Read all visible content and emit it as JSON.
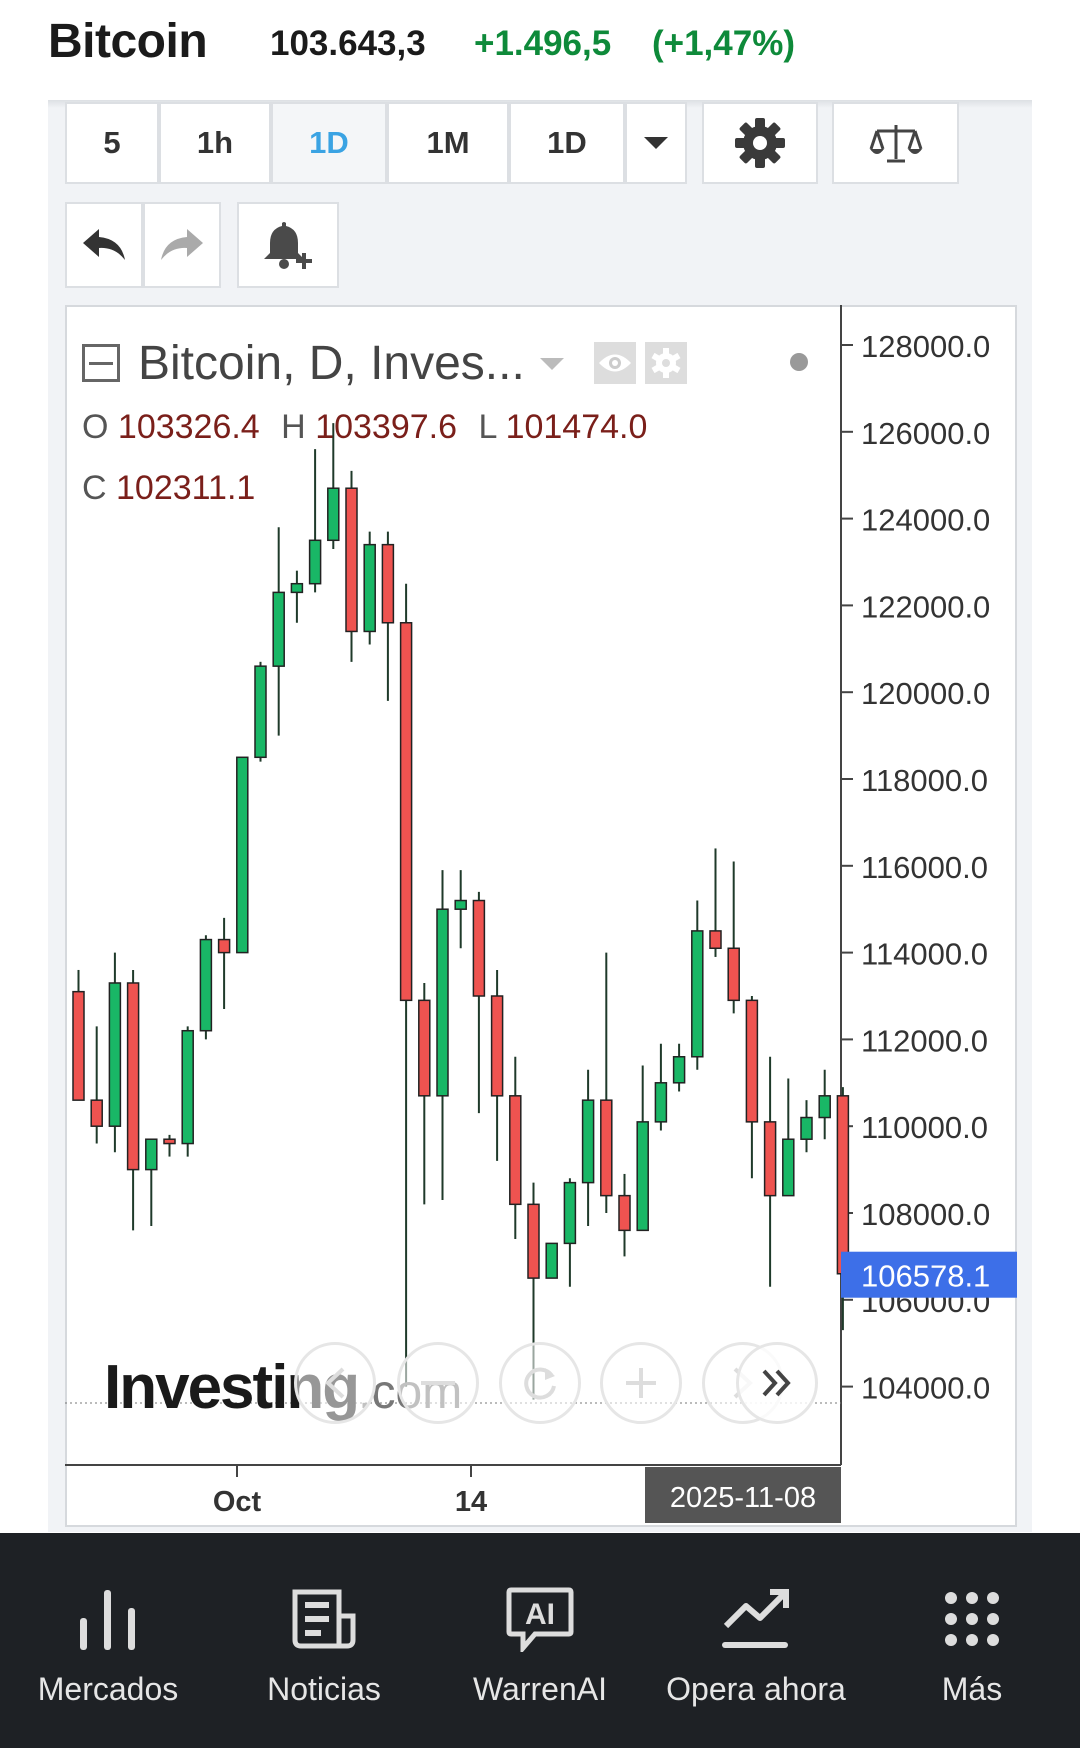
{
  "header": {
    "title": "Bitcoin",
    "price": "103.643,3",
    "change": "+1.496,5",
    "change_pct": "(+1,47%)",
    "up_color": "#0e8a3a"
  },
  "toolbar": {
    "intervals": [
      "5",
      "1h",
      "1D",
      "1M",
      "1D"
    ],
    "active_interval": "1D",
    "dropdown_icon": "caret-down-icon",
    "settings_icon": "gear-icon",
    "compare_icon": "scale-icon",
    "undo_icon": "undo-icon",
    "redo_icon": "redo-icon",
    "alert_icon": "bell-plus-icon"
  },
  "legend": {
    "title": "Bitcoin, D, Inves...",
    "o_label": "O",
    "o_value": "103326.4",
    "h_label": "H",
    "h_value": "103397.6",
    "l_label": "L",
    "l_value": "101474.0",
    "c_label": "C",
    "c_value": "102311.1"
  },
  "watermark": {
    "brand": "Investing",
    "suffix": ".com"
  },
  "nav_controls": [
    "chevron-left-icon",
    "minus-icon",
    "reset-icon",
    "plus-icon",
    "chevron-right-icon",
    "double-chevron-right-icon"
  ],
  "chart_data": {
    "type": "candlestick",
    "ylim": [
      102000,
      129000
    ],
    "y_ticks": [
      "128000.0",
      "126000.0",
      "124000.0",
      "122000.0",
      "120000.0",
      "118000.0",
      "116000.0",
      "114000.0",
      "112000.0",
      "110000.0",
      "108000.0",
      "106000.0",
      "104000.0"
    ],
    "x_ticks": [
      "Oct",
      "14",
      "2025-11-08"
    ],
    "current_price_label": "106578.1",
    "colors": {
      "up": "#19b766",
      "down": "#ef5350",
      "wick": "#1f3a2a",
      "price_tag": "#3d6fe8"
    },
    "candles": [
      {
        "o": 113100,
        "h": 113600,
        "l": 112000,
        "c": 110600
      },
      {
        "o": 110600,
        "h": 112300,
        "l": 109600,
        "c": 110000
      },
      {
        "o": 110000,
        "h": 114000,
        "l": 109400,
        "c": 113300
      },
      {
        "o": 113300,
        "h": 113600,
        "l": 107600,
        "c": 109000
      },
      {
        "o": 109000,
        "h": 109500,
        "l": 107700,
        "c": 109700
      },
      {
        "o": 109700,
        "h": 109800,
        "l": 109300,
        "c": 109600
      },
      {
        "o": 109600,
        "h": 112300,
        "l": 109300,
        "c": 112200
      },
      {
        "o": 112200,
        "h": 114400,
        "l": 112000,
        "c": 114300
      },
      {
        "o": 114300,
        "h": 114800,
        "l": 112700,
        "c": 114000
      },
      {
        "o": 114000,
        "h": 118500,
        "l": 114000,
        "c": 118500
      },
      {
        "o": 118500,
        "h": 120700,
        "l": 118400,
        "c": 120600
      },
      {
        "o": 120600,
        "h": 123800,
        "l": 119000,
        "c": 122300
      },
      {
        "o": 122300,
        "h": 122800,
        "l": 121600,
        "c": 122500
      },
      {
        "o": 122500,
        "h": 125600,
        "l": 122300,
        "c": 123500
      },
      {
        "o": 123500,
        "h": 126200,
        "l": 123300,
        "c": 124700
      },
      {
        "o": 124700,
        "h": 125100,
        "l": 120700,
        "c": 121400
      },
      {
        "o": 121400,
        "h": 123700,
        "l": 121100,
        "c": 123400
      },
      {
        "o": 123400,
        "h": 123700,
        "l": 119800,
        "c": 121600
      },
      {
        "o": 121600,
        "h": 122500,
        "l": 104000,
        "c": 112900
      },
      {
        "o": 112900,
        "h": 113300,
        "l": 108200,
        "c": 110700
      },
      {
        "o": 110700,
        "h": 115900,
        "l": 108300,
        "c": 115000
      },
      {
        "o": 115000,
        "h": 115900,
        "l": 114100,
        "c": 115200
      },
      {
        "o": 115200,
        "h": 115400,
        "l": 110300,
        "c": 113000
      },
      {
        "o": 113000,
        "h": 113600,
        "l": 109200,
        "c": 110700
      },
      {
        "o": 110700,
        "h": 111600,
        "l": 107400,
        "c": 108200
      },
      {
        "o": 108200,
        "h": 108700,
        "l": 103700,
        "c": 106500
      },
      {
        "o": 106500,
        "h": 107200,
        "l": 106500,
        "c": 107300
      },
      {
        "o": 107300,
        "h": 108800,
        "l": 106300,
        "c": 108700
      },
      {
        "o": 108700,
        "h": 111300,
        "l": 107700,
        "c": 110600
      },
      {
        "o": 110600,
        "h": 114000,
        "l": 108000,
        "c": 108400
      },
      {
        "o": 108400,
        "h": 108900,
        "l": 107000,
        "c": 107600
      },
      {
        "o": 107600,
        "h": 111400,
        "l": 107600,
        "c": 110100
      },
      {
        "o": 110100,
        "h": 111900,
        "l": 109900,
        "c": 111000
      },
      {
        "o": 111000,
        "h": 111900,
        "l": 110800,
        "c": 111600
      },
      {
        "o": 111600,
        "h": 115200,
        "l": 111300,
        "c": 114500
      },
      {
        "o": 114500,
        "h": 116400,
        "l": 113900,
        "c": 114100
      },
      {
        "o": 114100,
        "h": 116100,
        "l": 112600,
        "c": 112900
      },
      {
        "o": 112900,
        "h": 113000,
        "l": 108800,
        "c": 110100
      },
      {
        "o": 110100,
        "h": 111600,
        "l": 106300,
        "c": 108400
      },
      {
        "o": 108400,
        "h": 111100,
        "l": 108400,
        "c": 109700
      },
      {
        "o": 109700,
        "h": 110600,
        "l": 109400,
        "c": 110200
      },
      {
        "o": 110200,
        "h": 111300,
        "l": 109700,
        "c": 110700
      },
      {
        "o": 110700,
        "h": 110900,
        "l": 105300,
        "c": 106600
      }
    ]
  },
  "bottom_nav": [
    {
      "label": "Mercados",
      "icon": "bar-chart-icon"
    },
    {
      "label": "Noticias",
      "icon": "newspaper-icon"
    },
    {
      "label": "WarrenAI",
      "icon": "ai-chat-icon"
    },
    {
      "label": "Opera ahora",
      "icon": "trend-up-icon"
    },
    {
      "label": "Más",
      "icon": "grid-dots-icon"
    }
  ]
}
